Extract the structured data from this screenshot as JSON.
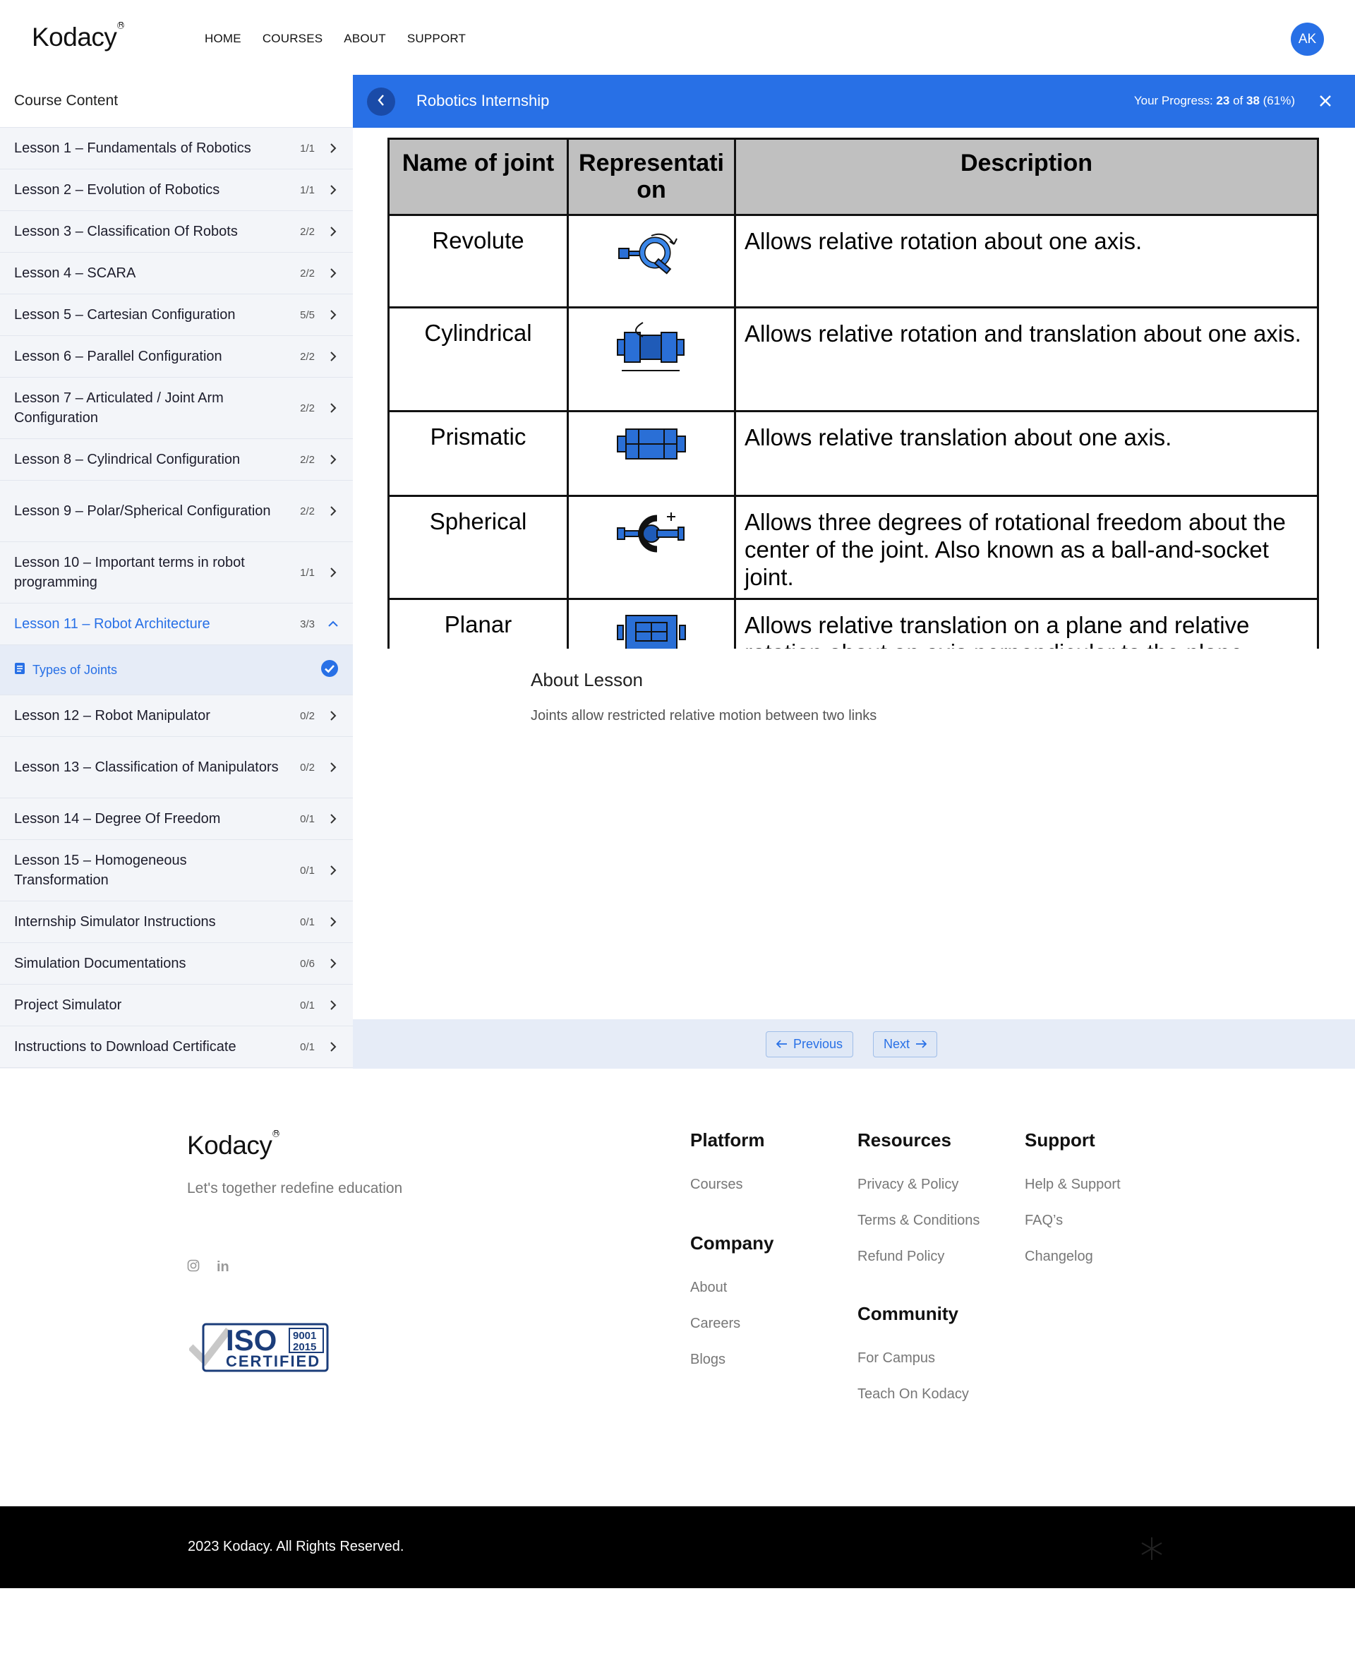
{
  "header": {
    "brand": "Kodacy",
    "nav": [
      "HOME",
      "COURSES",
      "ABOUT",
      "SUPPORT"
    ],
    "avatar": "AK"
  },
  "sidebar": {
    "title": "Course Content",
    "lessons": [
      {
        "title": "Lesson 1 – Fundamentals of Robotics",
        "count": "1/1"
      },
      {
        "title": "Lesson 2 – Evolution of Robotics",
        "count": "1/1"
      },
      {
        "title": "Lesson 3 – Classification Of Robots",
        "count": "2/2"
      },
      {
        "title": "Lesson 4 – SCARA",
        "count": "2/2"
      },
      {
        "title": "Lesson 5 – Cartesian Configuration",
        "count": "5/5"
      },
      {
        "title": "Lesson 6 – Parallel Configuration",
        "count": "2/2"
      },
      {
        "title": "Lesson 7 – Articulated / Joint Arm Configuration",
        "count": "2/2"
      },
      {
        "title": "Lesson 8 – Cylindrical Configuration",
        "count": "2/2"
      },
      {
        "title": "Lesson 9 – Polar/Spherical Configuration",
        "count": "2/2"
      },
      {
        "title": "Lesson 10 – Important terms in robot programming",
        "count": "1/1"
      },
      {
        "title": "Lesson 11 – Robot Architecture",
        "count": "3/3"
      },
      {
        "title": "Lesson 12 – Robot Manipulator",
        "count": "0/2"
      },
      {
        "title": "Lesson 13 – Classification of Manipulators",
        "count": "0/2"
      },
      {
        "title": "Lesson 14 – Degree Of Freedom",
        "count": "0/1"
      },
      {
        "title": "Lesson 15 – Homogeneous Transformation",
        "count": "0/1"
      },
      {
        "title": "Internship Simulator Instructions",
        "count": "0/1"
      },
      {
        "title": "Simulation Documentations",
        "count": "0/6"
      },
      {
        "title": "Project Simulator",
        "count": "0/1"
      },
      {
        "title": "Instructions to Download Certificate",
        "count": "0/1"
      }
    ],
    "active_sub": "Types of Joints"
  },
  "course_bar": {
    "title": "Robotics Internship",
    "progress_label": "Your Progress:",
    "progress_done": "23",
    "progress_of": "of",
    "progress_total": "38",
    "progress_pct": "(61%)"
  },
  "joint_table": {
    "headers": [
      "Name of joint",
      "Representati on",
      "Description"
    ],
    "rows": [
      {
        "name": "Revolute",
        "desc": "Allows relative rotation about one axis."
      },
      {
        "name": "Cylindrical",
        "desc": "Allows relative rotation and translation about one axis."
      },
      {
        "name": "Prismatic",
        "desc": "Allows relative translation about one axis."
      },
      {
        "name": "Spherical",
        "desc": "Allows three degrees of rotational freedom about the center of the joint. Also known as a ball-and-socket joint."
      },
      {
        "name": "Planar",
        "desc": "Allows relative translation on a plane and relative rotation about an axis perpendicular to the plane."
      }
    ]
  },
  "about": {
    "title": "About Lesson",
    "text": "Joints allow restricted relative motion between two links"
  },
  "pager": {
    "previous": "Previous",
    "next": "Next"
  },
  "footer": {
    "brand": "Kodacy",
    "tagline": "Let's together redefine education",
    "iso": {
      "top": "ISO",
      "year1": "9001",
      "year2": "2015",
      "bottom": "CERTIFIED"
    },
    "platform": {
      "title": "Platform",
      "links": [
        "Courses"
      ]
    },
    "company": {
      "title": "Company",
      "links": [
        "About",
        "Careers",
        "Blogs"
      ]
    },
    "resources": {
      "title": "Resources",
      "links": [
        "Privacy & Policy",
        "Terms & Conditions",
        "Refund Policy"
      ]
    },
    "community": {
      "title": "Community",
      "links": [
        "For Campus",
        "Teach On Kodacy"
      ]
    },
    "support": {
      "title": "Support",
      "links": [
        "Help & Support",
        "FAQ’s",
        "Changelog"
      ]
    },
    "copyright": "2023 Kodacy. All Rights Reserved."
  },
  "colors": {
    "accent": "#2870e6",
    "sidebar_bg": "#f3f5f9",
    "footer_bar": "#000000"
  }
}
